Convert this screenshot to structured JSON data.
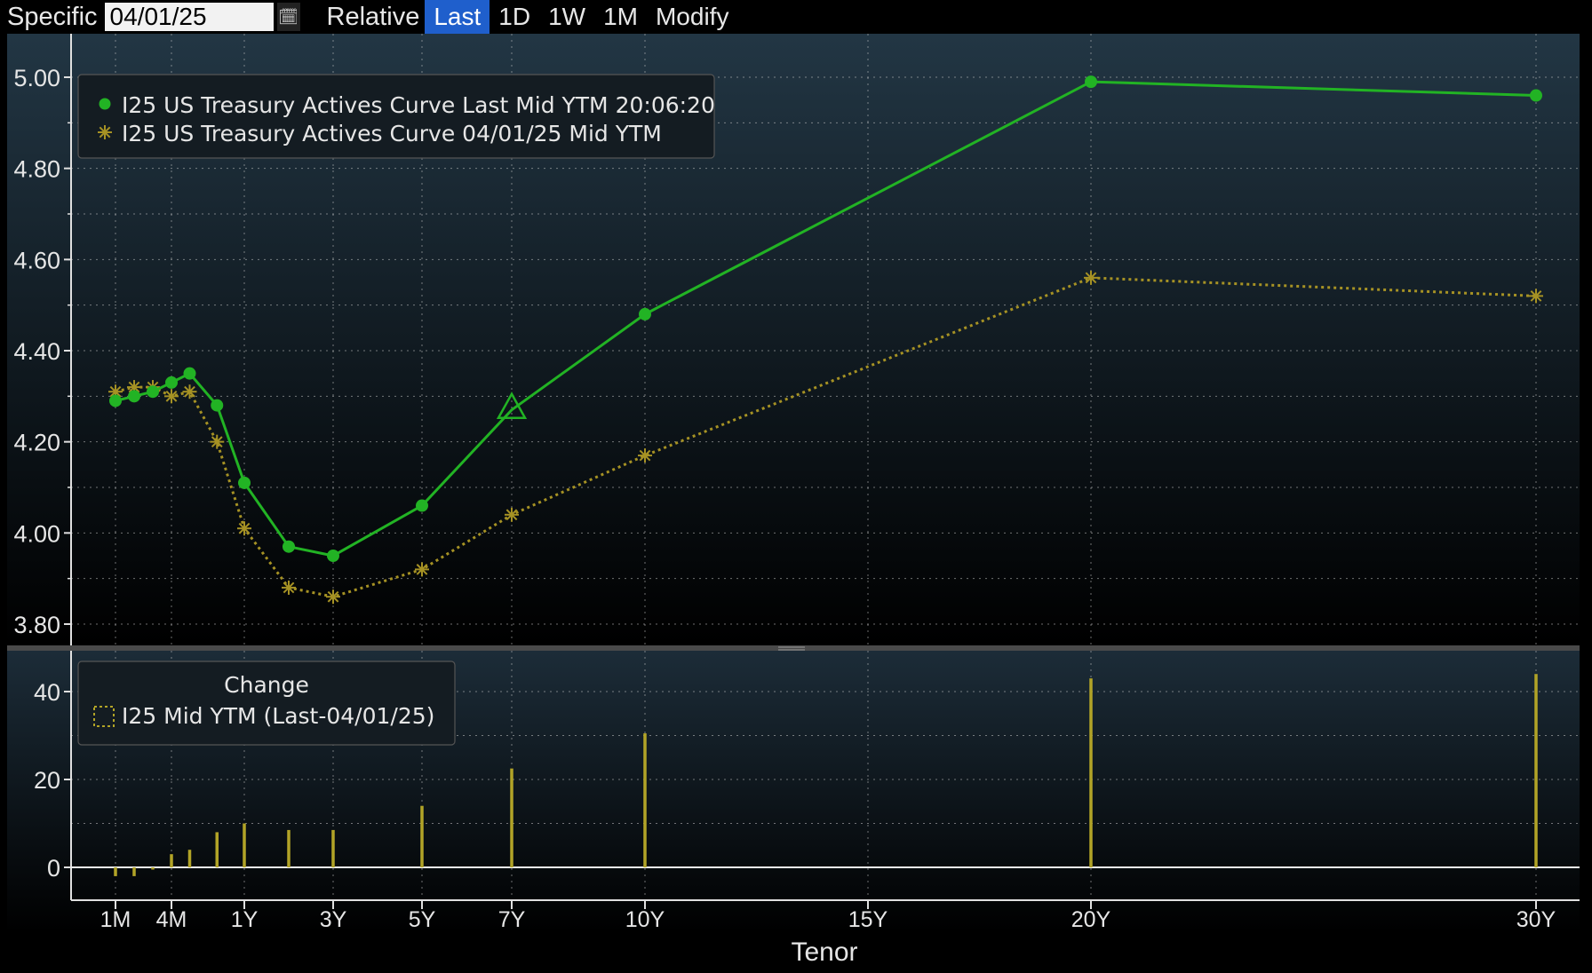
{
  "toolbar": {
    "specific_label": "Specific",
    "date_value": "04/01/25",
    "relative_label": "Relative",
    "buttons": [
      "Last",
      "1D",
      "1W",
      "1M",
      "Modify"
    ],
    "active": "Last"
  },
  "colors": {
    "current": "#22b324",
    "prior": "#a69224",
    "change": "#b2a427",
    "panel_legend_bg": "#141c22",
    "grid": "#c8c8c8"
  },
  "chart_data": [
    {
      "type": "line",
      "ylim": [
        3.78,
        5.12
      ],
      "yticks": [
        "5.00",
        "4.80",
        "4.60",
        "4.40",
        "4.20",
        "4.00",
        "3.80"
      ],
      "ytick_values": [
        5.0,
        4.8,
        4.6,
        4.4,
        4.2,
        4.0,
        3.8
      ],
      "grid": true,
      "legend": "top-left",
      "series": [
        {
          "name": "I25 US Treasury Actives Curve Last Mid YTM 20:06:20",
          "style": "solid-dot",
          "x": [
            1,
            2,
            3,
            4,
            6,
            9,
            12,
            24,
            36,
            60,
            84,
            120,
            240,
            360
          ],
          "y": [
            4.29,
            4.3,
            4.31,
            4.33,
            4.35,
            4.28,
            4.11,
            3.97,
            3.95,
            4.06,
            4.27,
            4.48,
            4.99,
            4.96
          ]
        },
        {
          "name": "I25 US Treasury Actives Curve 04/01/25 Mid YTM",
          "style": "dotted-star",
          "x": [
            1,
            2,
            3,
            4,
            6,
            9,
            12,
            24,
            36,
            60,
            84,
            120,
            240,
            360
          ],
          "y": [
            4.31,
            4.32,
            4.32,
            4.3,
            4.31,
            4.2,
            4.01,
            3.88,
            3.86,
            3.92,
            4.04,
            4.17,
            4.56,
            4.52
          ]
        }
      ],
      "marker_triangle": {
        "x": 84,
        "y": 4.27
      }
    },
    {
      "type": "bar",
      "title": "Change",
      "series": [
        {
          "name": "I25 Mid YTM (Last-04/01/25)",
          "x": [
            1,
            2,
            3,
            4,
            6,
            9,
            12,
            24,
            36,
            60,
            84,
            120,
            240,
            360
          ],
          "values": [
            -2,
            -2,
            -0.5,
            3,
            4,
            8,
            10,
            8.5,
            8.5,
            14,
            22.5,
            30.5,
            43,
            44
          ]
        }
      ],
      "ylim": [
        -4,
        48
      ],
      "yticks": [
        "40",
        "20",
        "0"
      ],
      "ytick_values": [
        40,
        20,
        0
      ],
      "grid": true,
      "legend": "top-left"
    }
  ],
  "x_axis": {
    "label": "Tenor",
    "ticks": [
      {
        "label": "1M",
        "months": 1
      },
      {
        "label": "4M",
        "months": 4
      },
      {
        "label": "1Y",
        "months": 12
      },
      {
        "label": "3Y",
        "months": 36
      },
      {
        "label": "5Y",
        "months": 60
      },
      {
        "label": "7Y",
        "months": 84
      },
      {
        "label": "10Y",
        "months": 120
      },
      {
        "label": "15Y",
        "months": 180
      },
      {
        "label": "20Y",
        "months": 240
      },
      {
        "label": "30Y",
        "months": 360
      }
    ]
  }
}
